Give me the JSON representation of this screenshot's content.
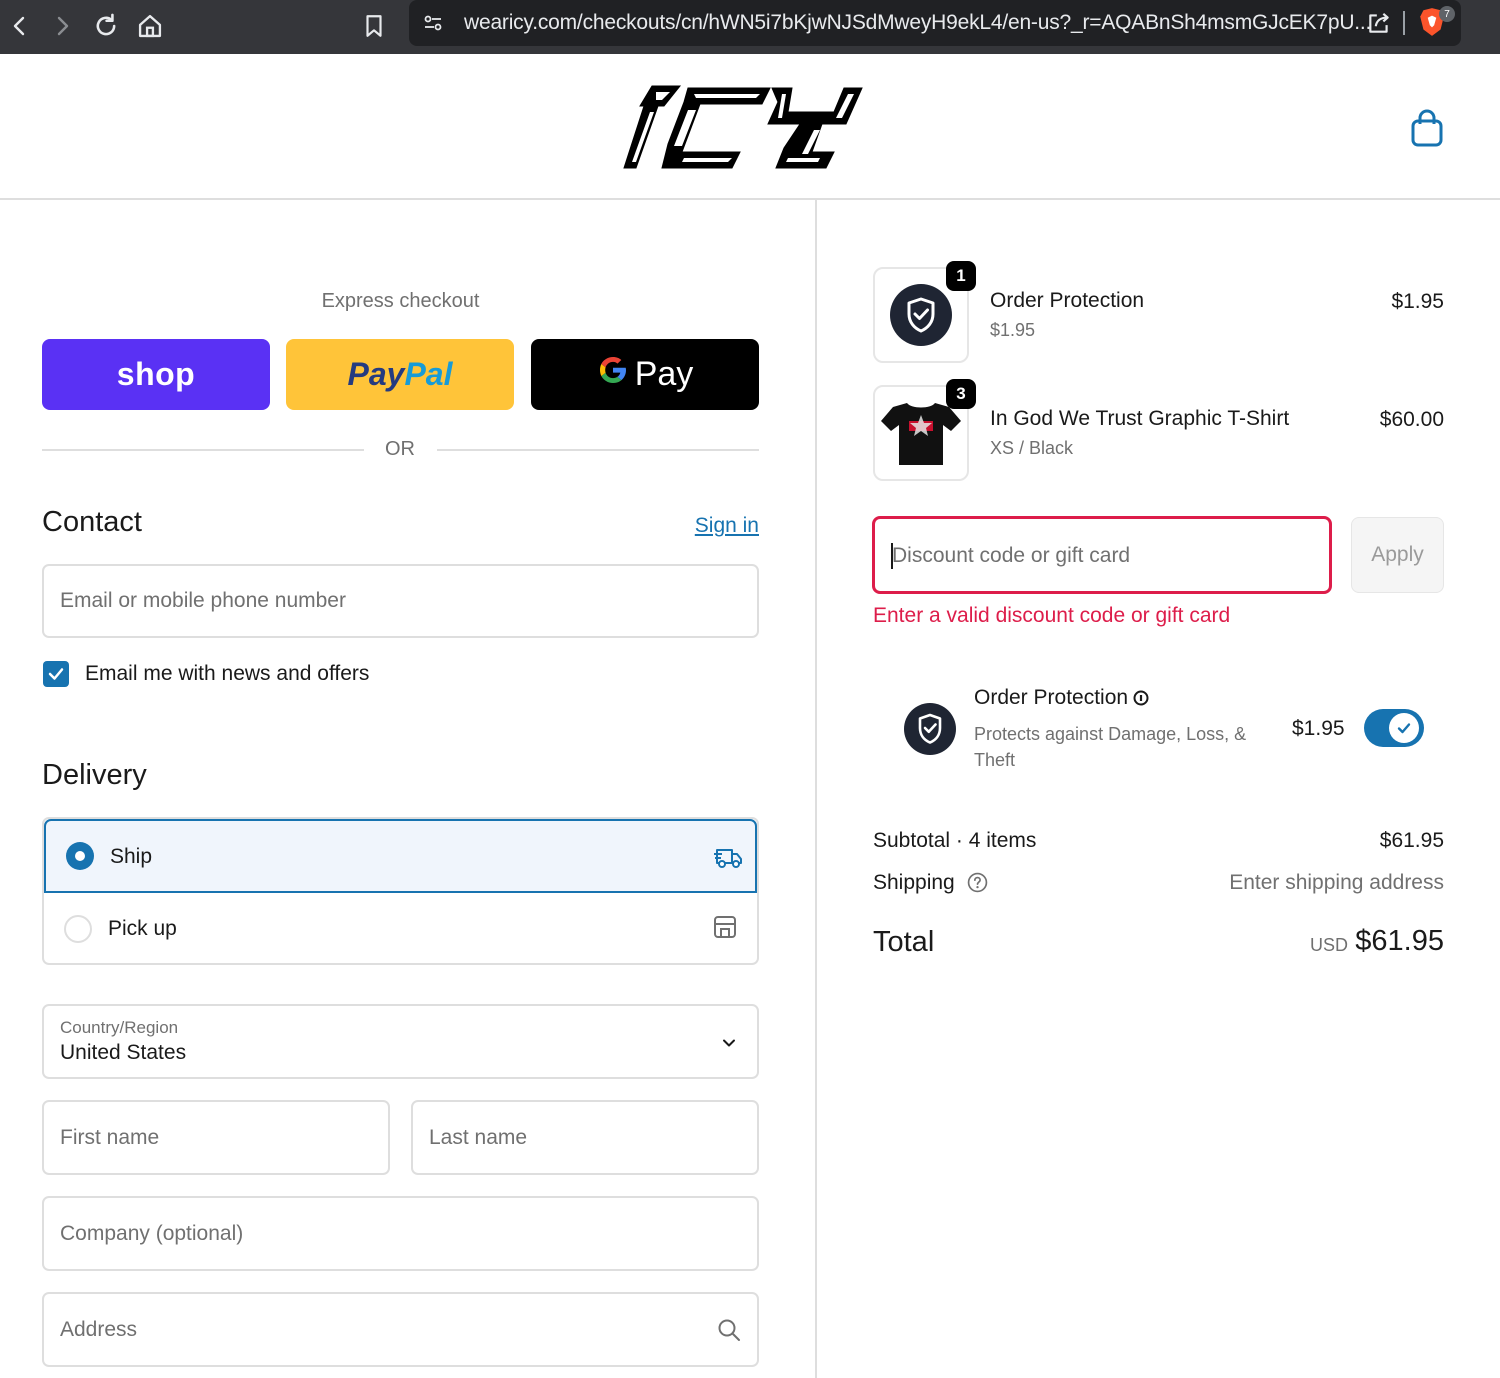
{
  "browser": {
    "url": "wearicy.com/checkouts/cn/hWN5i7bKjwNJSdMweyH9ekL4/en-us?_r=AQABnSh4msmGJcEK7pU...",
    "extension_badge": "7"
  },
  "header": {
    "logo_alt": "ICY"
  },
  "express": {
    "label": "Express checkout",
    "shop_label": "shop",
    "paypal_part1": "Pay",
    "paypal_part2": "Pal",
    "gpay_g": "G",
    "gpay_label": "Pay",
    "or_label": "OR"
  },
  "contact": {
    "title": "Contact",
    "sign_in": "Sign in",
    "email_placeholder": "Email or mobile phone number",
    "news_checkbox_label": "Email me with news and offers",
    "news_checked": true
  },
  "delivery": {
    "title": "Delivery",
    "options": [
      {
        "label": "Ship",
        "selected": true,
        "icon": "truck-icon"
      },
      {
        "label": "Pick up",
        "selected": false,
        "icon": "store-icon"
      }
    ],
    "country_label": "Country/Region",
    "country_value": "United States",
    "first_name_placeholder": "First name",
    "last_name_placeholder": "Last name",
    "company_placeholder": "Company (optional)",
    "address_placeholder": "Address"
  },
  "order": {
    "items": [
      {
        "name": "Order Protection",
        "subtitle": "$1.95",
        "price": "$1.95",
        "quantity": "1",
        "icon": "shield-check-icon"
      },
      {
        "name": "In God We Trust Graphic T-Shirt",
        "subtitle": "XS / Black",
        "price": "$60.00",
        "quantity": "3",
        "icon": "tshirt-image"
      }
    ],
    "discount_placeholder": "Discount code or gift card",
    "apply_label": "Apply",
    "discount_error": "Enter a valid discount code or gift card",
    "protection": {
      "title": "Order Protection",
      "description": "Protects against Damage, Loss, & Theft",
      "price": "$1.95",
      "enabled": true
    },
    "subtotal_label": "Subtotal · 4 items",
    "subtotal_value": "$61.95",
    "shipping_label": "Shipping",
    "shipping_value": "Enter shipping address",
    "total_label": "Total",
    "total_currency": "USD",
    "total_value": "$61.95"
  },
  "colors": {
    "accent": "#1773b0",
    "error": "#dd1d4a",
    "shop_purple": "#5a31f4",
    "paypal_yellow": "#ffc439"
  }
}
